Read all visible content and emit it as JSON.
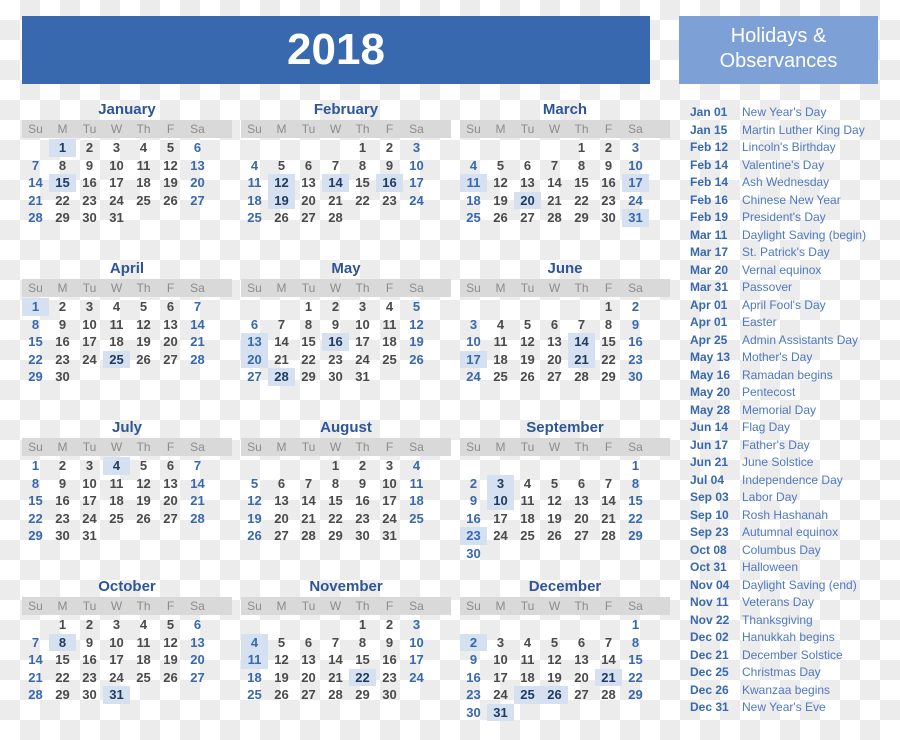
{
  "header": {
    "year": "2018"
  },
  "holidays_panel": {
    "title_line1": "Holidays &",
    "title_line2": "Observances",
    "items": [
      {
        "date": "Jan 01",
        "name": "New Year's Day"
      },
      {
        "date": "Jan 15",
        "name": "Martin Luther King Day"
      },
      {
        "date": "Feb 12",
        "name": "Lincoln's Birthday"
      },
      {
        "date": "Feb 14",
        "name": "Valentine's Day"
      },
      {
        "date": "Feb 14",
        "name": "Ash Wednesday"
      },
      {
        "date": "Feb 16",
        "name": "Chinese New Year"
      },
      {
        "date": "Feb 19",
        "name": "President's Day"
      },
      {
        "date": "Mar 11",
        "name": "Daylight Saving (begin)"
      },
      {
        "date": "Mar 17",
        "name": "St. Patrick's Day"
      },
      {
        "date": "Mar 20",
        "name": "Vernal equinox"
      },
      {
        "date": "Mar 31",
        "name": "Passover"
      },
      {
        "date": "Apr 01",
        "name": "April Fool's Day"
      },
      {
        "date": "Apr 01",
        "name": "Easter"
      },
      {
        "date": "Apr 25",
        "name": "Admin Assistants Day"
      },
      {
        "date": "May 13",
        "name": "Mother's Day"
      },
      {
        "date": "May 16",
        "name": "Ramadan begins"
      },
      {
        "date": "May 20",
        "name": "Pentecost"
      },
      {
        "date": "May 28",
        "name": "Memorial Day"
      },
      {
        "date": "Jun 14",
        "name": "Flag Day"
      },
      {
        "date": "Jun 17",
        "name": "Father's Day"
      },
      {
        "date": "Jun 21",
        "name": "June Solstice"
      },
      {
        "date": "Jul 04",
        "name": "Independence Day"
      },
      {
        "date": "Sep 03",
        "name": "Labor Day"
      },
      {
        "date": "Sep 10",
        "name": "Rosh Hashanah"
      },
      {
        "date": "Sep 23",
        "name": "Autumnal equinox"
      },
      {
        "date": "Oct 08",
        "name": "Columbus Day"
      },
      {
        "date": "Oct 31",
        "name": "Halloween"
      },
      {
        "date": "Nov 04",
        "name": "Daylight Saving (end)"
      },
      {
        "date": "Nov 11",
        "name": "Veterans Day"
      },
      {
        "date": "Nov 22",
        "name": "Thanksgiving"
      },
      {
        "date": "Dec 02",
        "name": "Hanukkah begins"
      },
      {
        "date": "Dec 21",
        "name": "December Solstice"
      },
      {
        "date": "Dec 25",
        "name": "Christmas Day"
      },
      {
        "date": "Dec 26",
        "name": "Kwanzaa begins"
      },
      {
        "date": "Dec 31",
        "name": "New Year's Eve"
      }
    ]
  },
  "weekday_labels": [
    "Su",
    "M",
    "Tu",
    "W",
    "Th",
    "F",
    "Sa"
  ],
  "months": [
    {
      "name": "January",
      "start": 1,
      "days": 31,
      "highlight": [
        1,
        15
      ]
    },
    {
      "name": "February",
      "start": 4,
      "days": 28,
      "highlight": [
        12,
        14,
        16,
        19
      ]
    },
    {
      "name": "March",
      "start": 4,
      "days": 31,
      "highlight": [
        11,
        17,
        20,
        31
      ]
    },
    {
      "name": "April",
      "start": 0,
      "days": 30,
      "highlight": [
        1,
        25
      ]
    },
    {
      "name": "May",
      "start": 2,
      "days": 31,
      "highlight": [
        13,
        16,
        20,
        28
      ]
    },
    {
      "name": "June",
      "start": 5,
      "days": 30,
      "highlight": [
        14,
        17,
        21
      ]
    },
    {
      "name": "July",
      "start": 0,
      "days": 31,
      "highlight": [
        4
      ]
    },
    {
      "name": "August",
      "start": 3,
      "days": 31,
      "highlight": []
    },
    {
      "name": "September",
      "start": 6,
      "days": 30,
      "highlight": [
        3,
        10,
        23
      ]
    },
    {
      "name": "October",
      "start": 1,
      "days": 31,
      "highlight": [
        8,
        31
      ]
    },
    {
      "name": "November",
      "start": 4,
      "days": 30,
      "highlight": [
        4,
        11,
        22
      ]
    },
    {
      "name": "December",
      "start": 6,
      "days": 31,
      "highlight": [
        2,
        21,
        25,
        26,
        31
      ]
    }
  ],
  "colors": {
    "banner": "#3868ad",
    "holiday_banner": "#7da1d6",
    "weekend_text": "#3868ad",
    "weekday_text": "#4a4a4a",
    "highlight_bg": "#d5e1f1"
  }
}
